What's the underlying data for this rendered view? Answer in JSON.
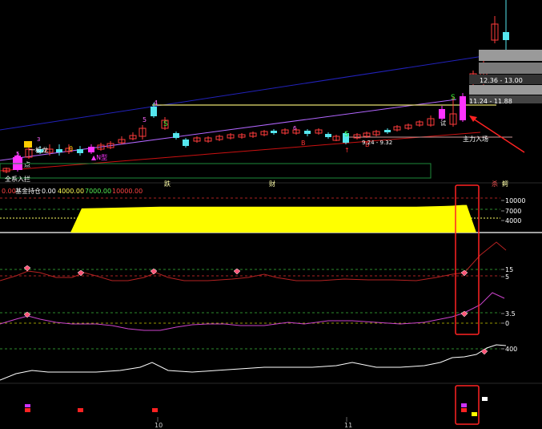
{
  "colors": {
    "up": "#ff3b3b",
    "down": "#55e6ee",
    "magenta": "#ff33ff",
    "yellow": "#ffff00",
    "white": "#ffffff",
    "green_dash": "#2e8b2e",
    "red_dash": "#aa2222",
    "trend_blue": "#2222bb",
    "trend_violet": "#b266ff",
    "trend_red": "#cc1111",
    "level_line": "#e8e070",
    "grey_box": "#9a9a9a"
  },
  "price_panel": {
    "annotations": {
      "box_1": "12.36 - 13.00",
      "box_2": "11.24 - 11.88",
      "range_label": "9.24 - 9.32",
      "entry_label": "主力入场",
      "left_tag_1": "一板龙",
      "left_tag_2": "点",
      "left_tag_3": "▲N型",
      "buy_tag": "B",
      "sell_tag": "S",
      "num_4": "4",
      "num_5": "5",
      "num_3": "3",
      "num_6": "6",
      "num_0": "0",
      "right_small": "试"
    },
    "bottom_labels": {
      "left": "全系入拦",
      "mid_1": "跌",
      "mid_2": "财",
      "right_1": "杀",
      "right_2": "鳄"
    }
  },
  "fund_panel": {
    "title": "基金持仓",
    "values": [
      "0.00",
      "4000.00",
      "7000.00",
      "10000.00"
    ],
    "prefix_value": "0.00",
    "axis_ticks": [
      "10000",
      "7000",
      "4000"
    ]
  },
  "osc_panel_1": {
    "axis_ticks": [
      "15",
      "5"
    ]
  },
  "osc_panel_2": {
    "axis_ticks": [
      "3.5",
      "0"
    ]
  },
  "line_panel": {
    "axis_ticks": [
      "400"
    ]
  },
  "x_axis": {
    "ticks": [
      "10",
      "11"
    ]
  },
  "chart_data": {
    "type": "line",
    "title": "",
    "x_ticks": [
      "10",
      "11"
    ],
    "panels": [
      {
        "name": "基金持仓",
        "ticks": [
          10000,
          7000,
          4000
        ],
        "series": [
          {
            "values": [
              0,
              0,
              7000,
              7500,
              7500,
              7500,
              7500,
              7500,
              7500,
              7500,
              7500,
              7600,
              7700,
              7800,
              7900,
              8000,
              8000,
              0
            ]
          }
        ]
      },
      {
        "ticks": [
          15,
          5
        ]
      },
      {
        "ticks": [
          3.5,
          0
        ]
      },
      {
        "ticks": [
          400
        ]
      }
    ]
  }
}
